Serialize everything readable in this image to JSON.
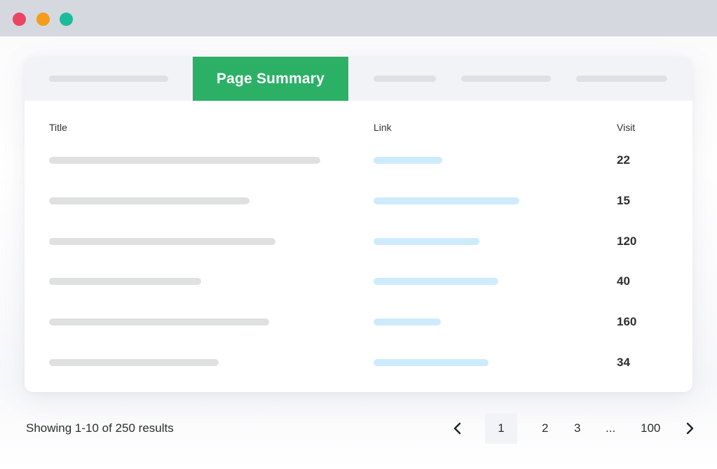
{
  "window": {
    "controls": [
      {
        "name": "close",
        "color": "#ec4561"
      },
      {
        "name": "minimize",
        "color": "#f49d1a"
      },
      {
        "name": "maximize",
        "color": "#1abc9c"
      }
    ]
  },
  "tabs": {
    "active_label": "Page Summary",
    "active_color": "#2bb066",
    "placeholder_tab_count": 4
  },
  "table": {
    "columns": [
      "Title",
      "Link",
      "Visit"
    ],
    "rows": [
      {
        "title": "",
        "link": "",
        "visit": "22"
      },
      {
        "title": "",
        "link": "",
        "visit": "15"
      },
      {
        "title": "",
        "link": "",
        "visit": "120"
      },
      {
        "title": "",
        "link": "",
        "visit": "40"
      },
      {
        "title": "",
        "link": "",
        "visit": "160"
      },
      {
        "title": "",
        "link": "",
        "visit": "34"
      }
    ],
    "placeholder_colors": {
      "title": "#dfe0e0",
      "link": "#cdebfc"
    }
  },
  "footer": {
    "results_text": "Showing 1-10 of 250 results"
  },
  "pagination": {
    "prev_icon": "chevron-left-icon",
    "next_icon": "chevron-right-icon",
    "pages": [
      "1",
      "2",
      "3",
      "...",
      "100"
    ],
    "current": "1"
  }
}
